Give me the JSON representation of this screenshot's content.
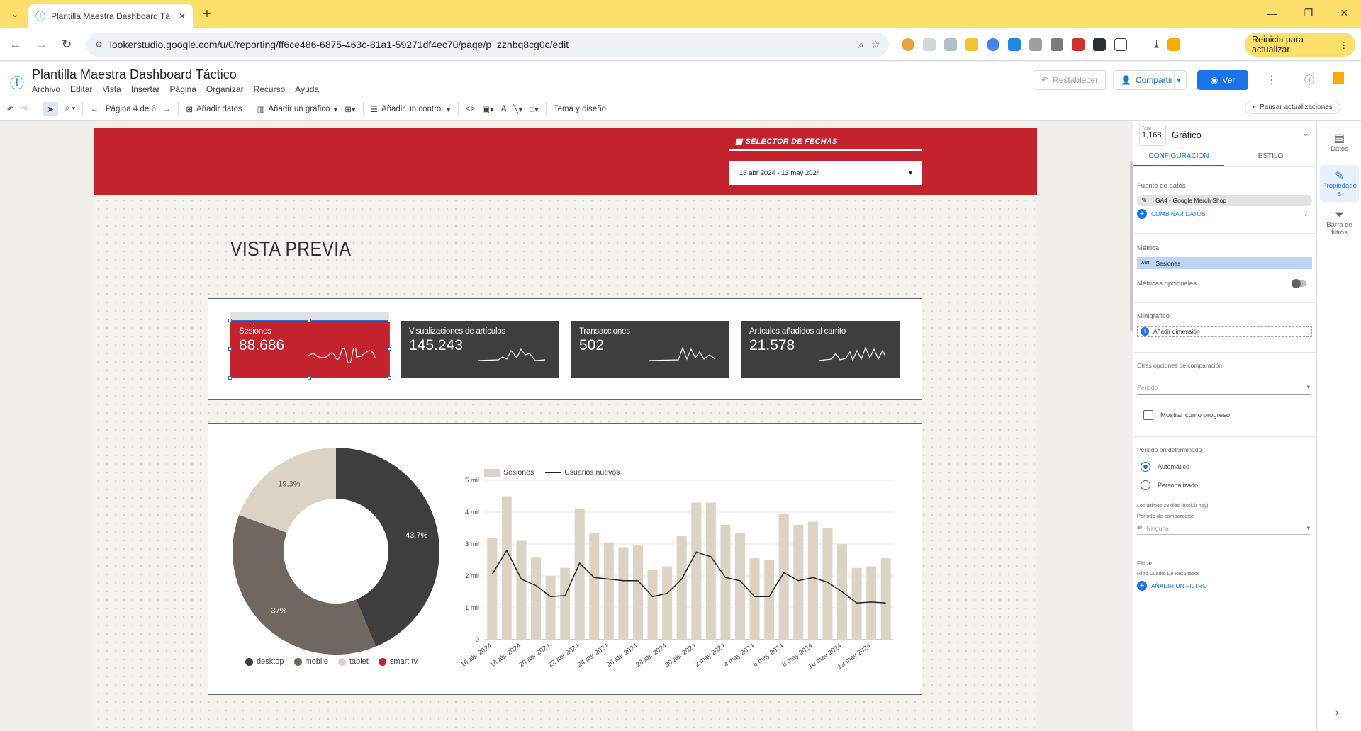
{
  "browser": {
    "tab_title": "Plantilla Maestra Dashboard Tá",
    "url": "lookerstudio.google.com/u/0/reporting/ff6ce486-6875-463c-81a1-59271df4ec70/page/p_zznbq8cg0c/edit",
    "update_button": "Reinicia para actualizar"
  },
  "app": {
    "title": "Plantilla Maestra Dashboard Táctico",
    "menu": [
      "Archivo",
      "Editar",
      "Vista",
      "Insertar",
      "Página",
      "Organizar",
      "Recurso",
      "Ayuda"
    ],
    "reset_label": "Restablecer",
    "share_label": "Compartir",
    "view_label": "Ver"
  },
  "toolbar": {
    "page_label": "Página 4 de 6",
    "add_data": "Añadir datos",
    "add_chart": "Añadir un gráfico",
    "add_control": "Añadir un control",
    "theme": "Tema y diseño",
    "pause": "Pausar actualizaciones"
  },
  "report": {
    "selector_label": "SELECTOR DE FECHAS",
    "date_range": "16 abr 2024 - 13 may 2024",
    "date_arrow": "▾",
    "heading": "VISTA PREVIA",
    "kpis": [
      {
        "label": "Sesiones",
        "value": "88.686"
      },
      {
        "label": "Visualizaciones de artículos",
        "value": "145.243"
      },
      {
        "label": "Transacciones",
        "value": "502"
      },
      {
        "label": "Artículos añadidos al carrito",
        "value": "21.578"
      }
    ]
  },
  "chart_data": [
    {
      "type": "pie",
      "donut": true,
      "slices": [
        {
          "name": "desktop",
          "value": 43.7,
          "label": "43,7%",
          "color": "#3e3e3e"
        },
        {
          "name": "mobile",
          "value": 37.0,
          "label": "37%",
          "color": "#6f6760"
        },
        {
          "name": "tablet",
          "value": 19.3,
          "label": "19,3%",
          "color": "#dcd3c5"
        },
        {
          "name": "smart tv",
          "value": 0.0,
          "label": "",
          "color": "#c4222d"
        }
      ],
      "legend": "bottom"
    },
    {
      "type": "bar",
      "categories": [
        "16 abr 2024",
        "17 abr 2024",
        "18 abr 2024",
        "19 abr 2024",
        "20 abr 2024",
        "21 abr 2024",
        "22 abr 2024",
        "23 abr 2024",
        "24 abr 2024",
        "25 abr 2024",
        "26 abr 2024",
        "27 abr 2024",
        "28 abr 2024",
        "29 abr 2024",
        "30 abr 2024",
        "1 may 2024",
        "2 may 2024",
        "3 may 2024",
        "4 may 2024",
        "5 may 2024",
        "6 may 2024",
        "7 may 2024",
        "8 may 2024",
        "9 may 2024",
        "10 may 2024",
        "11 may 2024",
        "12 may 2024",
        "13 may 2024"
      ],
      "tick_labels": [
        "16 abr 2024",
        "18 abr 2024",
        "20 abr 2024",
        "22 abr 2024",
        "24 abr 2024",
        "26 abr 2024",
        "28 abr 2024",
        "30 abr 2024",
        "2 may 2024",
        "4 may 2024",
        "6 may 2024",
        "8 may 2024",
        "10 may 2024",
        "12 may 2024"
      ],
      "series": [
        {
          "name": "Sesiones",
          "type": "bar",
          "color": "#dcd3c5",
          "values": [
            3200,
            4500,
            3100,
            2600,
            2000,
            2250,
            4100,
            3350,
            3050,
            2900,
            2950,
            2200,
            2300,
            3250,
            4300,
            4300,
            3600,
            3350,
            2550,
            2500,
            3950,
            3600,
            3700,
            3500,
            3000,
            2250,
            2300,
            2550
          ]
        },
        {
          "name": "Usuarios nuevos",
          "type": "line",
          "color": "#202124",
          "values": [
            2050,
            2800,
            1900,
            1700,
            1350,
            1380,
            2400,
            1950,
            1900,
            1850,
            1850,
            1350,
            1450,
            1900,
            2750,
            2600,
            1950,
            1850,
            1350,
            1350,
            2100,
            1850,
            1950,
            1800,
            1500,
            1150,
            1180,
            1150
          ]
        }
      ],
      "y_ticks": [
        "0",
        "1 mil",
        "2 mil",
        "3 mil",
        "4 mil",
        "5 mil"
      ],
      "ylim": [
        0,
        5000
      ],
      "legend": "top-left"
    }
  ],
  "panel": {
    "total_label": "Total",
    "total_value": "1,168",
    "chart_type": "Gráfico",
    "tab_config": "CONFIGURACIÓN",
    "tab_style": "ESTILO",
    "datasource_heading": "Fuente de datos",
    "datasource": "GA4 - Google Merch Shop",
    "blend": "COMBINAR DATOS",
    "metric_heading": "Métrica",
    "metric_tag": "AUT",
    "metric": "Sesiones",
    "optional_metrics": "Métricas opcionales",
    "sparkline_heading": "Minigráfico",
    "add_dimension": "Añadir dimensión",
    "comparison_heading": "Otras opciones de comparación",
    "period_placeholder": "Periodo",
    "show_progress": "Mostrar como progreso",
    "default_period_heading": "Periodo predeterminado",
    "auto": "Automático",
    "custom": "Personalizado",
    "last28": "Los últimos 28 días (excluir hoy)",
    "comparison_period": "Periodo de comparación",
    "none": "Ninguna",
    "filter_heading": "Filtrar",
    "filter_sub": "Filtro Cuadro De Resultados",
    "add_filter": "AÑADIR UN FILTRO"
  },
  "rail": {
    "data": "Datos",
    "properties": "Propiedades",
    "filter_bar": "Barra de filtros"
  }
}
